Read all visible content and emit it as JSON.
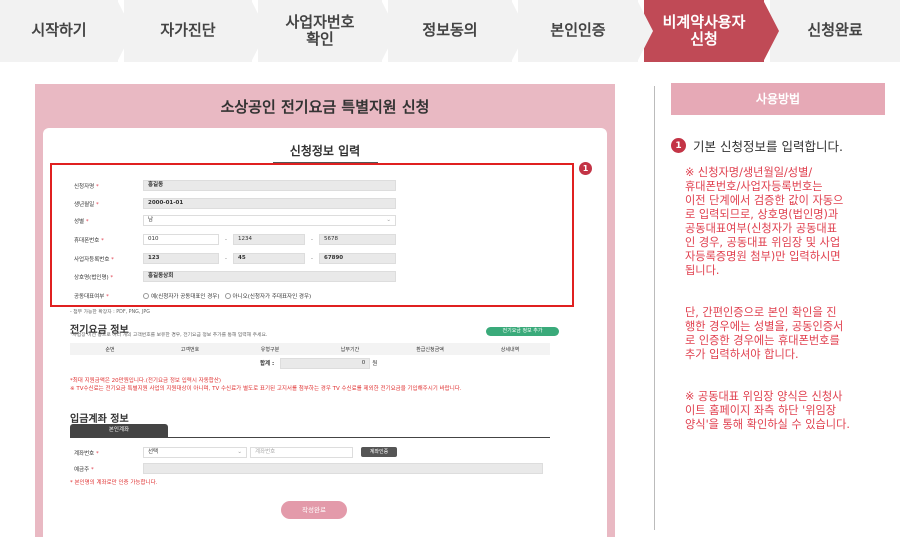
{
  "steps": [
    {
      "label": "시작하기",
      "active": false
    },
    {
      "label": "자가진단",
      "active": false
    },
    {
      "label": "사업자번호\n확인",
      "active": false
    },
    {
      "label": "정보동의",
      "active": false
    },
    {
      "label": "본인인증",
      "active": false
    },
    {
      "label": "비계약사용자\n신청",
      "active": true
    },
    {
      "label": "신청완료",
      "active": false
    }
  ],
  "form": {
    "header": "소상공인 전기요금 특별지원 신청",
    "card_title": "신청정보 입력",
    "fields": {
      "name_label": "신청자명",
      "name_value": "홍길동",
      "birth_label": "생년월일",
      "birth_value": "2000-01-01",
      "gender_label": "성별",
      "gender_value": "남",
      "phone_label": "휴대폰번호",
      "phone_1": "010",
      "phone_2": "1234",
      "phone_3": "5678",
      "bizno_label": "사업자등록번호",
      "bizno_1": "123",
      "bizno_2": "45",
      "bizno_3": "67890",
      "company_label": "상호명(법인명)",
      "company_value": "홍길동상회",
      "ceo_label": "공동대표여부",
      "ceo_opt_yes": "예(신청자가 공동대표인 경우)",
      "ceo_opt_no": "아니오(신청자가 주대표자인 경우)",
      "required_mark": "*"
    },
    "file_note": "- 첨부 가능한 확장자 : PDF, PNG, JPG",
    "electric": {
      "title": "전기요금 정보",
      "subtitle": "*사업장 이전 등으로 여러 개의 고객번호를 보유한 경우, 전기요금 정보 추가를 통해 입력해 주세요.",
      "add_btn": "전기요금 정보 추가",
      "cols": [
        "순번",
        "고객번호",
        "유형구분",
        "납부기간",
        "환급신청금액",
        "상세내역"
      ],
      "total_label": "합계 :",
      "total_value": "0",
      "total_unit": "원",
      "note_max": "*최대 지원금액은 20만원입니다.(전기요금 정보 입력시 자동합산)",
      "note_tv": "※ TV수신료는 전기요금 특별지원 사업의 지원대상이 아니며, TV 수신료가 별도로 표기된 고지서를 첨부하는 경우 TV 수신료를 제외한 전기요금을 기입해주시기 바랍니다."
    },
    "deposit": {
      "title": "입금계좌 정보",
      "tab": "본인계좌",
      "account_label": "계좌번호",
      "bank_select": "선택",
      "account_placeholder": "계좌번호",
      "verify_btn": "계좌인증",
      "holder_label": "예금주",
      "note": "* 본인명의 계좌로만 인증 가능합니다."
    },
    "submit": "작성완료"
  },
  "help": {
    "button": "사용방법",
    "step_num": "1",
    "step_text": "기본 신청정보를 입력합니다.",
    "para1": "※ 신청자명/생년월일/성별/\n휴대폰번호/사업자등록번호는\n이전 단계에서 검증한 값이 자동으\n로 입력되므로, 상호명(법인명)과\n공동대표여부(신청자가 공동대표\n인 경우, 공동대표 위임장 및 사업\n자등록증명원 첨부)만 입력하시면\n됩니다.",
    "para2": "단, 간편인증으로 본인 확인을 진\n행한 경우에는 성별을, 공동인증서\n로 인증한 경우에는 휴대폰번호를\n추가 입력하셔야 합니다.",
    "para3": "※ 공동대표 위임장 양식은 신청사\n이트 홈페이지 좌측 하단 '위임장\n양식'을 통해 확인하실 수 있습니다."
  },
  "colors": {
    "active_step": "#c04a56",
    "step_bg": "#f2f2f2",
    "form_bg": "#e9b9c3",
    "help_button": "#e6a9b6",
    "help_text": "#e0404f",
    "highlight": "#e02020",
    "badge": "#c33446"
  }
}
